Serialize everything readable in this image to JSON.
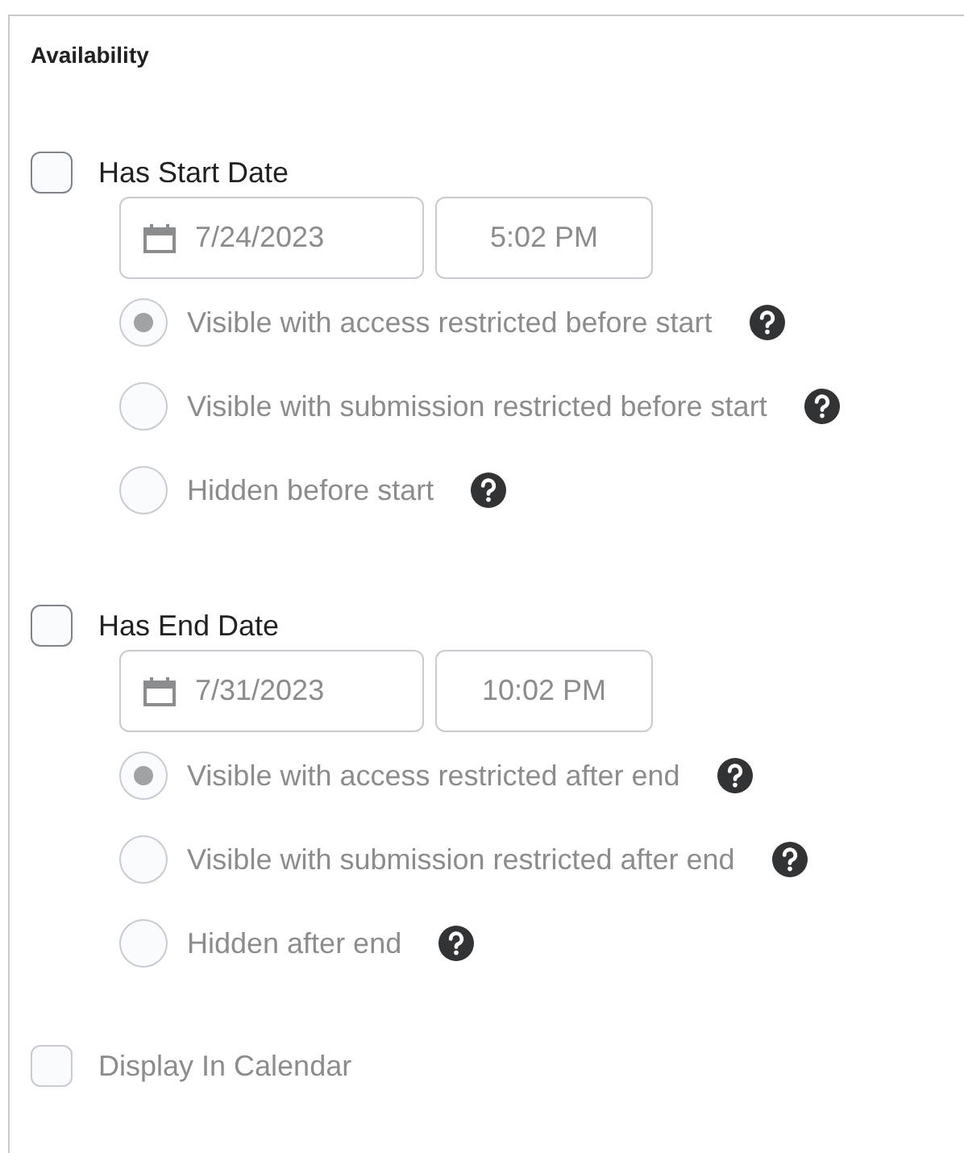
{
  "title": "Availability",
  "sections": [
    {
      "label": "Has Start Date",
      "checked": false,
      "date": "7/24/2023",
      "time": "5:02 PM",
      "options": [
        {
          "label": "Visible with access restricted before start",
          "selected": true,
          "disabled": true
        },
        {
          "label": "Visible with submission restricted before start",
          "selected": false,
          "disabled": true
        },
        {
          "label": "Hidden before start",
          "selected": false,
          "disabled": true
        }
      ]
    },
    {
      "label": "Has End Date",
      "checked": false,
      "date": "7/31/2023",
      "time": "10:02 PM",
      "options": [
        {
          "label": "Visible with access restricted after end",
          "selected": true,
          "disabled": true
        },
        {
          "label": "Visible with submission restricted after end",
          "selected": false,
          "disabled": true
        },
        {
          "label": "Hidden after end",
          "selected": false,
          "disabled": true
        }
      ]
    }
  ],
  "calendar": {
    "label": "Display In Calendar",
    "checked": false,
    "disabled": true
  }
}
